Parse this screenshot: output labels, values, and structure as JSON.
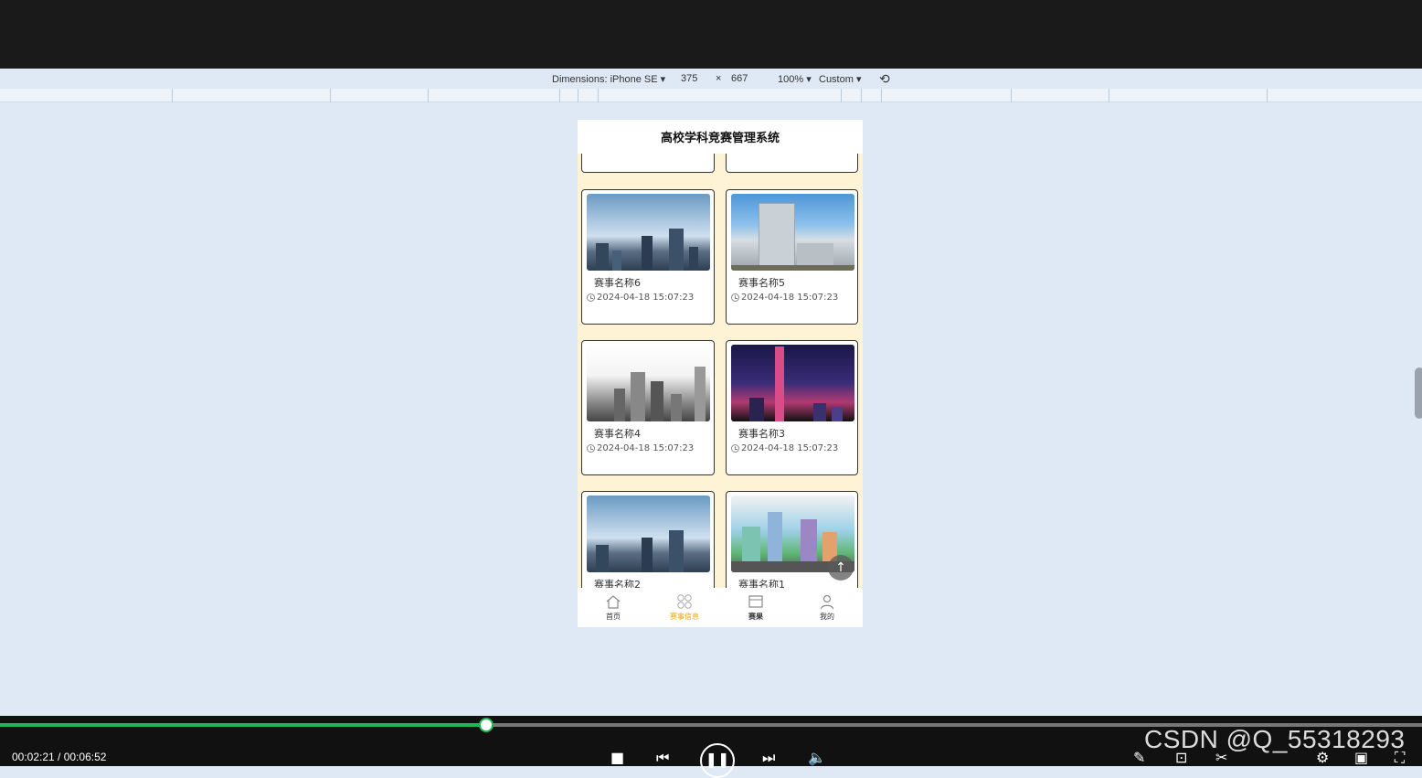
{
  "devtools": {
    "dimensions_label": "Dimensions: iPhone SE ▾",
    "width_value": "375",
    "times": "×",
    "height_value": "667",
    "zoom": "100% ▾",
    "throttle": "Custom ▾"
  },
  "app": {
    "title": "高校学科竞赛管理系统",
    "cards": [
      {
        "name": "赛事名称6",
        "time": "2024-04-18 15:07:23",
        "img": "cityA"
      },
      {
        "name": "赛事名称5",
        "time": "2024-04-18 15:07:23",
        "img": "cityB"
      },
      {
        "name": "赛事名称4",
        "time": "2024-04-18 15:07:23",
        "img": "cityC"
      },
      {
        "name": "赛事名称3",
        "time": "2024-04-18 15:07:23",
        "img": "cityD"
      },
      {
        "name": "赛事名称2",
        "time": "",
        "img": "cityA"
      },
      {
        "name": "赛事名称1",
        "time": "",
        "img": "cityE"
      }
    ],
    "tabs": [
      {
        "label": "首页",
        "icon": "home-icon"
      },
      {
        "label": "赛事信息",
        "icon": "grid-icon",
        "active": true
      },
      {
        "label": "赛果",
        "icon": "calendar-icon"
      },
      {
        "label": "我的",
        "icon": "user-icon"
      }
    ],
    "colors": {
      "accent": "#f0a500",
      "list_bg": "#fff3d6"
    }
  },
  "player": {
    "time": "00:02:21 / 00:06:52",
    "progress_fraction": 0.342,
    "watermark": "CSDN @Q_55318293"
  }
}
